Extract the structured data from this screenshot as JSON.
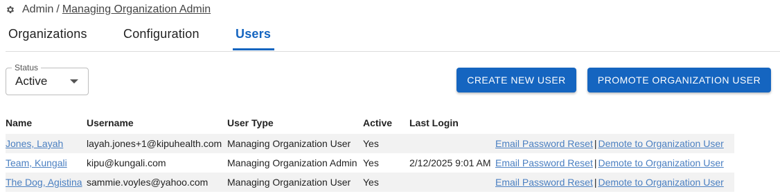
{
  "breadcrumb": {
    "icon": "gear-icon",
    "root": "Admin",
    "separator": "/",
    "current": "Managing Organization Admin"
  },
  "tabs": [
    {
      "label": "Organizations",
      "active": false
    },
    {
      "label": "Configuration",
      "active": false
    },
    {
      "label": "Users",
      "active": true
    }
  ],
  "filter": {
    "label": "Status",
    "value": "Active"
  },
  "actions": {
    "create": "CREATE NEW USER",
    "promote": "PROMOTE ORGANIZATION USER"
  },
  "table": {
    "columns": [
      "Name",
      "Username",
      "User Type",
      "Active",
      "Last Login"
    ],
    "rows": [
      {
        "name": "Jones, Layah",
        "username": "layah.jones+1@kipuhealth.com",
        "user_type": "Managing Organization User",
        "active": "Yes",
        "last_login": "",
        "action1": "Email Password Reset",
        "divider": "|",
        "action2": "Demote to Organization User"
      },
      {
        "name": "Team, Kungali",
        "username": "kipu@kungali.com",
        "user_type": "Managing Organization Admin",
        "active": "Yes",
        "last_login": "2/12/2025 9:01 AM",
        "action1": "Email Password Reset",
        "divider": "|",
        "action2": "Demote to Organization User"
      },
      {
        "name": "The Dog, Agistina",
        "username": "sammie.voyles@yahoo.com",
        "user_type": "Managing Organization User",
        "active": "Yes",
        "last_login": "",
        "action1": "Email Password Reset",
        "divider": "|",
        "action2": "Demote to Organization User"
      }
    ]
  },
  "colors": {
    "accent": "#1565c0",
    "link": "#4a7fc1",
    "row_shade": "#f2f2f2"
  }
}
